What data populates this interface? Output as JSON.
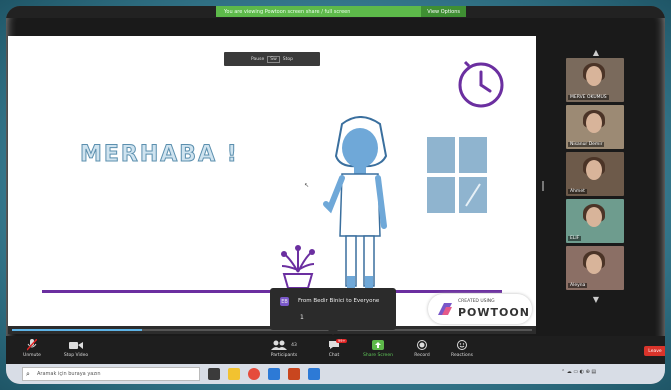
{
  "banner": {
    "sharing_text": "You are viewing Powtoon screen share / full screen",
    "options_label": "View Options"
  },
  "slide": {
    "pause_text": "Pause",
    "pause_box": "Sw",
    "pause_tail": "Stop",
    "greeting": "MERHABA !",
    "progress_fraction": 0.25,
    "powtoon_small": "CREATED USING",
    "powtoon_big": "POWTOON"
  },
  "chat_popup": {
    "avatar_letter": "EB",
    "from": "From Bedir Binici to Everyone",
    "message": "1"
  },
  "gallery": {
    "participants": [
      {
        "name": "MERVE OKUMUS",
        "bg": "#7a6a5c"
      },
      {
        "name": "Nisanur Demir",
        "bg": "#9c8a74"
      },
      {
        "name": "Ahmet",
        "bg": "#6d5a4a"
      },
      {
        "name": "ELIF",
        "bg": "#6e9c8e"
      },
      {
        "name": "Aleyna",
        "bg": "#8b6f65"
      }
    ]
  },
  "toolbar": {
    "unmute": "Unmute",
    "stop_video": "Stop Video",
    "participants": "Participants",
    "participants_count": "43",
    "chat": "Chat",
    "chat_badge": "99+",
    "share_screen": "Share Screen",
    "record": "Record",
    "reactions": "Reactions",
    "leave": "Leave"
  },
  "taskbar": {
    "search_placeholder": "Aramak için buraya yazın"
  },
  "colors": {
    "accent_purple": "#6b2fa0",
    "figure_blue": "#6fa8d8",
    "window_blue": "#8fb4cf",
    "zoom_green": "#5db94a",
    "leave_red": "#d9342b"
  }
}
